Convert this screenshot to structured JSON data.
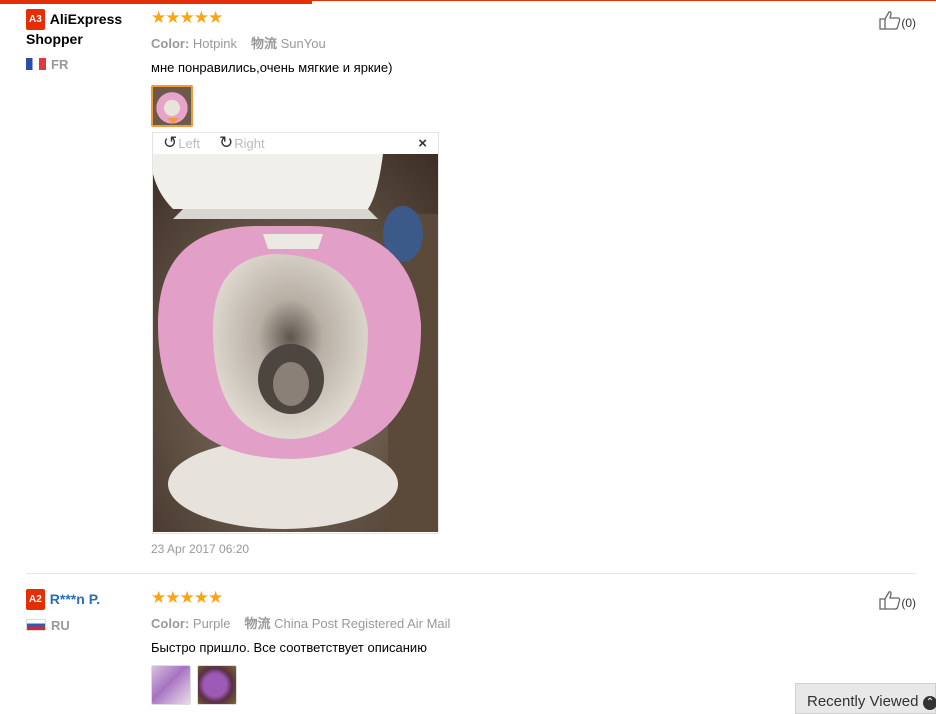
{
  "reviews": [
    {
      "badge": "A3",
      "user_name_line1": "AliExpress",
      "user_name_line2": "Shopper",
      "country": "FR",
      "stars": "★★★★★",
      "color_label": "Color:",
      "color_value": "Hotpink",
      "shipping_label": "物流",
      "shipping_value": "SunYou",
      "feedback": "мне понравились,очень мягкие и яркие)",
      "helpful_count": "(0)",
      "viewer": {
        "rotate_left": "Left",
        "rotate_right": "Right",
        "close": "×"
      },
      "date": "23 Apr 2017 06:20"
    },
    {
      "badge": "A2",
      "user_name": "R***n P.",
      "country": "RU",
      "stars": "★★★★★",
      "color_label": "Color:",
      "color_value": "Purple",
      "shipping_label": "物流",
      "shipping_value": "China Post Registered Air Mail",
      "feedback": "Быстро пришло. Все соответствует описанию",
      "helpful_count": "(0)"
    }
  ],
  "recently_viewed": "Recently Viewed",
  "colors": {
    "accent": "#e62e04",
    "star": "#f7a614",
    "user_link": "#2a6ebb"
  },
  "icons": [
    "thumbs-up-icon",
    "rotate-left-icon",
    "rotate-right-icon",
    "close-icon",
    "chevron-up-icon",
    "flag-fr-icon",
    "flag-ru-icon"
  ]
}
